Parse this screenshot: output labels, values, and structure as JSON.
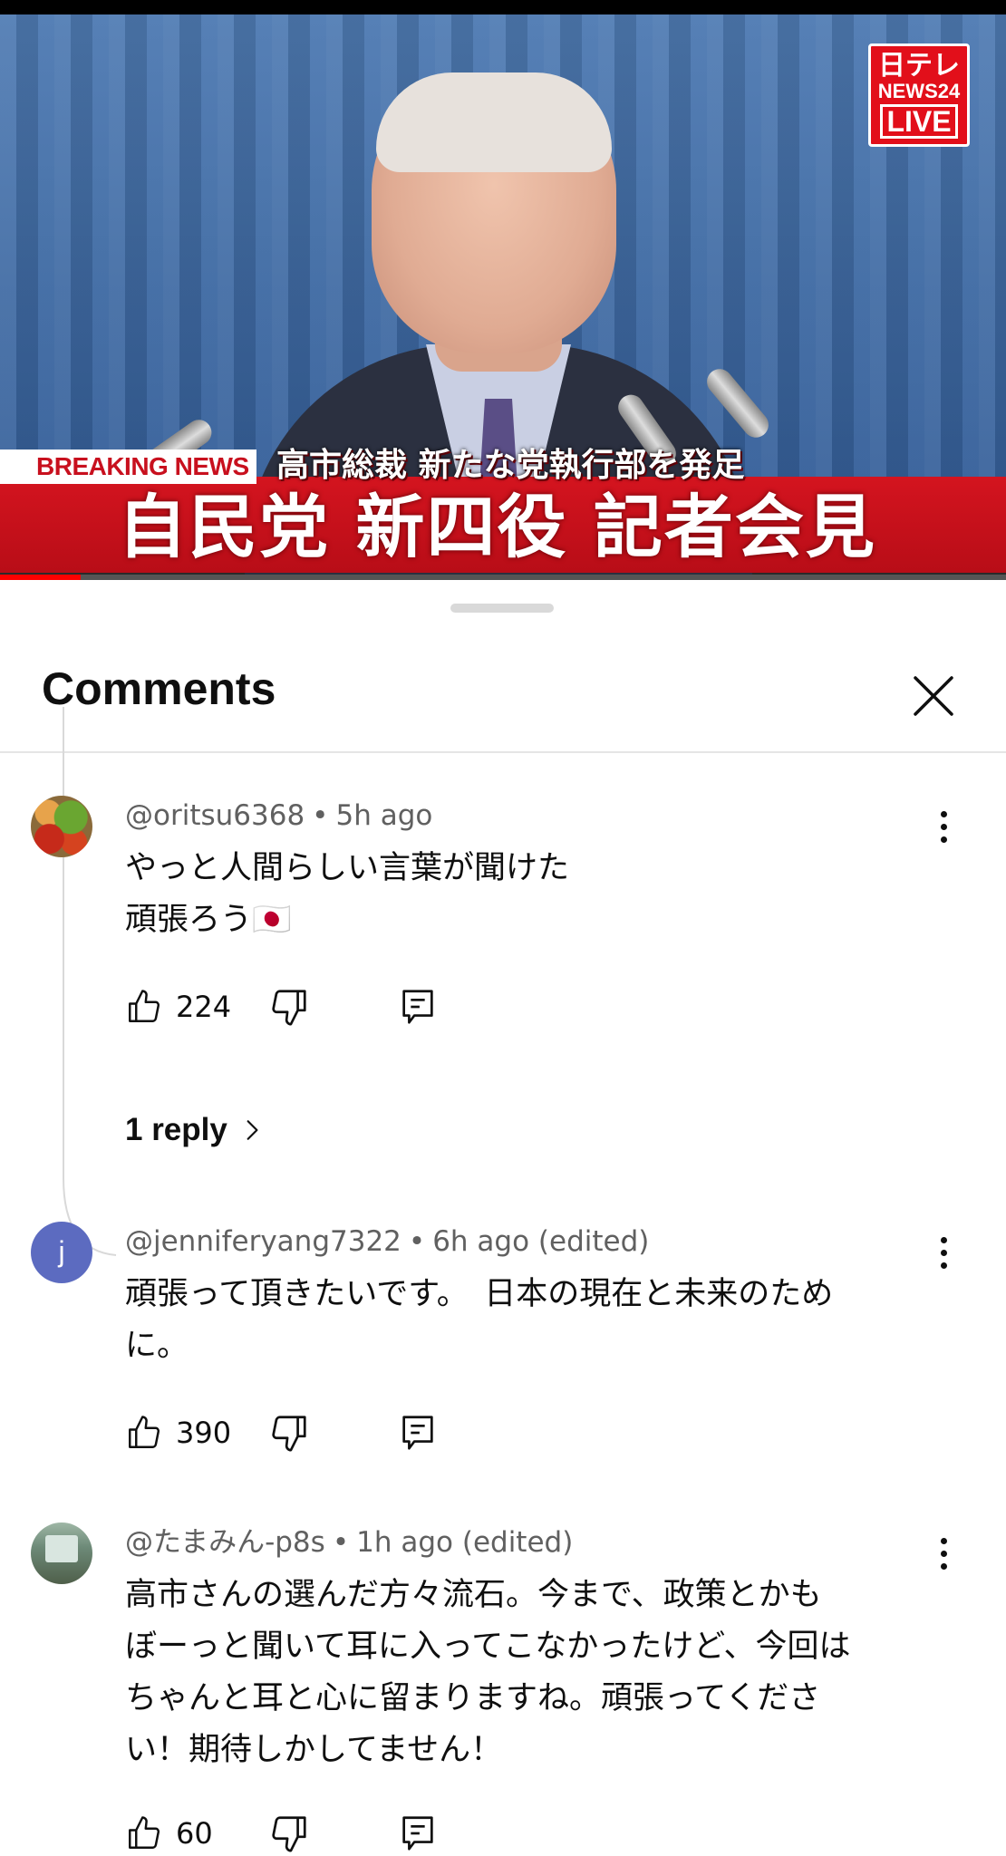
{
  "video": {
    "logo_line1": "日テレ",
    "logo_line2": "NEWS24",
    "logo_line3": "LIVE",
    "breaking_label": "BREAKING NEWS",
    "subheadline": "高市総裁 新たな党執行部を発足",
    "headline": "自民党 新四役 記者会見",
    "progress": 0.08,
    "colors": {
      "banner_red": "#c8101e",
      "progress_red": "#ff0000"
    }
  },
  "sheet": {
    "title": "Comments",
    "close_icon": "close-icon"
  },
  "comments": [
    {
      "author": "@oritsu6368",
      "time": "5h ago",
      "edited": "",
      "lines": [
        "やっと人間らしい言葉が聞けた",
        "頑張ろう🇯🇵"
      ],
      "likes": "224",
      "replies_label": "1 reply"
    },
    {
      "author": "@jenniferyang7322",
      "avatar_letter": "j",
      "time": "6h ago",
      "edited": "(edited)",
      "lines": [
        "頑張って頂きたいです。　日本の現在と未来のため",
        "に。"
      ],
      "likes": "390"
    },
    {
      "author": "@たまみん-p8s",
      "time": "1h ago",
      "edited": "(edited)",
      "lines": [
        "高市さんの選んだ方々流石。今まで、政策とかも",
        "ぼーっと聞いて耳に入ってこなかったけど、今回は",
        "ちゃんと耳と心に留まりますね。頑張ってくださ",
        "い！期待しかしてません！"
      ],
      "likes": "60"
    }
  ]
}
